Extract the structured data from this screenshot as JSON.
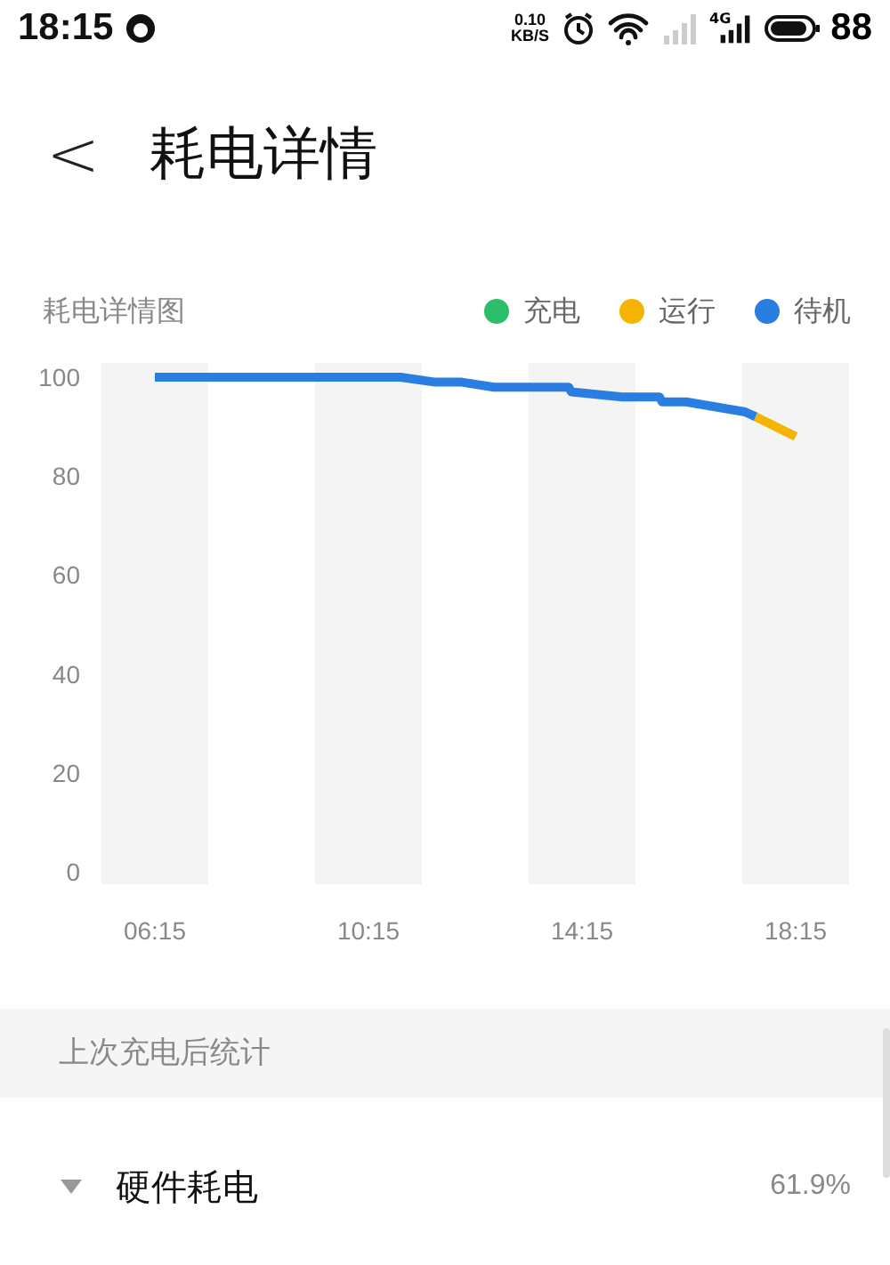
{
  "status_bar": {
    "time": "18:15",
    "speed_value": "0.10",
    "speed_unit": "KB/S",
    "network": "4G",
    "battery": "88"
  },
  "header": {
    "back": "<",
    "title": "耗电详情"
  },
  "chart_card": {
    "title": "耗电详情图",
    "chart_data": {
      "type": "line",
      "x": [
        6.25,
        10.85,
        11.5,
        12,
        12.6,
        14,
        14.05,
        15,
        15.7,
        15.75,
        16.2,
        17.3,
        17.5,
        18.25
      ],
      "series": [
        {
          "name": "充电",
          "color": "#2ebd6b",
          "values": [
            null,
            null,
            null,
            null,
            null,
            null,
            null,
            null,
            null,
            null,
            null,
            null,
            null,
            null
          ]
        },
        {
          "name": "运行",
          "color": "#f5b400",
          "values": [
            null,
            null,
            null,
            null,
            null,
            null,
            null,
            null,
            null,
            null,
            null,
            null,
            92,
            88
          ]
        },
        {
          "name": "待机",
          "color": "#2a7de1",
          "values": [
            100,
            100,
            99,
            99,
            98,
            98,
            97,
            96,
            96,
            95,
            95,
            93,
            92,
            null
          ]
        }
      ],
      "xlim": [
        6.25,
        18.25
      ],
      "ylim": [
        0,
        100
      ],
      "xticks": [
        {
          "value": 6.25,
          "label": "06:15"
        },
        {
          "value": 10.25,
          "label": "10:15"
        },
        {
          "value": 14.25,
          "label": "14:15"
        },
        {
          "value": 18.25,
          "label": "18:15"
        }
      ],
      "yticks": [
        0,
        20,
        40,
        60,
        80,
        100
      ]
    }
  },
  "section_header": "上次充电后统计",
  "rows": [
    {
      "label": "硬件耗电",
      "value": "61.9%",
      "expanded": true
    }
  ]
}
